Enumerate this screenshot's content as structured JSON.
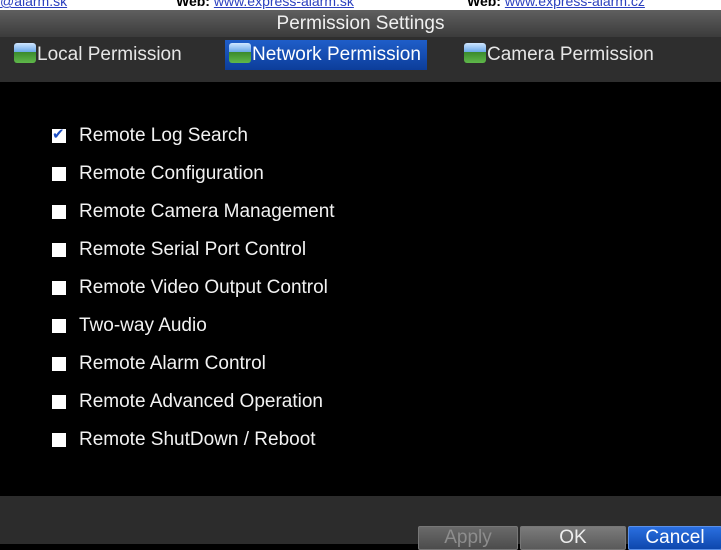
{
  "header_strip": {
    "link1": "@alarm.sk",
    "web_label_1": "Web:",
    "link2": "www.express-alarm.sk",
    "web_label_2": "Web:",
    "link3": "www.express-alarm.cz"
  },
  "window": {
    "title": "Permission Settings"
  },
  "tabs": [
    {
      "label": "Local Permission",
      "icon": "camera-icon",
      "active": false
    },
    {
      "label": "Network Permission",
      "icon": "camera-icon",
      "active": true
    },
    {
      "label": "Camera Permission",
      "icon": "camera-icon",
      "active": false
    }
  ],
  "permissions": [
    {
      "label": "Remote Log Search",
      "checked": true
    },
    {
      "label": "Remote Configuration",
      "checked": false
    },
    {
      "label": "Remote Camera Management",
      "checked": false
    },
    {
      "label": "Remote Serial Port Control",
      "checked": false
    },
    {
      "label": "Remote Video Output Control",
      "checked": false
    },
    {
      "label": "Two-way Audio",
      "checked": false
    },
    {
      "label": "Remote Alarm Control",
      "checked": false
    },
    {
      "label": "Remote Advanced Operation",
      "checked": false
    },
    {
      "label": "Remote ShutDown / Reboot",
      "checked": false
    }
  ],
  "buttons": {
    "apply": "Apply",
    "ok": "OK",
    "cancel": "Cancel"
  },
  "colors": {
    "active_tab": "#1f5ec9",
    "cancel_button": "#1d5ad0",
    "background": "#000000"
  }
}
